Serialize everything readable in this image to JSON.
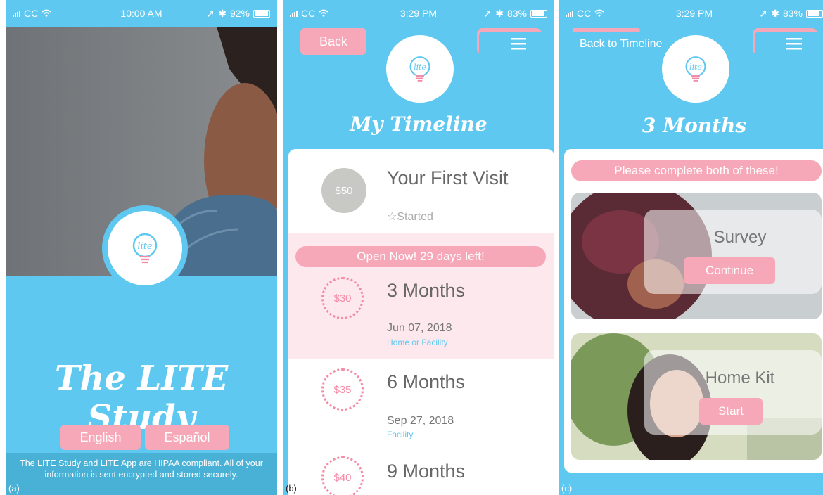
{
  "panel_a": {
    "status": {
      "carrier": "CC",
      "time": "10:00 AM",
      "battery": "92%",
      "battery_level": 0.92
    },
    "title": "The LITE Study",
    "logo_text": "lite",
    "buttons": {
      "english": "English",
      "espanol": "Español"
    },
    "disclaimer": "The LITE Study and LITE App are HIPAA compliant. All of your information is sent encrypted and stored securely.",
    "label": "(a)"
  },
  "panel_b": {
    "status": {
      "carrier": "CC",
      "time": "3:29 PM",
      "battery": "83%",
      "battery_level": 0.83
    },
    "back_label": "Back",
    "logo_text": "lite",
    "title": "My Timeline",
    "open_banner": "Open Now!  29 days left!",
    "items": [
      {
        "amount": "$50",
        "title": "Your First Visit",
        "status": "☆Started",
        "date": "",
        "location": ""
      },
      {
        "amount": "$30",
        "title": "3 Months",
        "status": "",
        "date": "Jun 07, 2018",
        "location": "Home or Facility"
      },
      {
        "amount": "$35",
        "title": "6 Months",
        "status": "",
        "date": "Sep 27, 2018",
        "location": "Facility"
      },
      {
        "amount": "$40",
        "title": "9 Months",
        "status": "",
        "date": "",
        "location": ""
      }
    ],
    "label": "(b)"
  },
  "panel_c": {
    "status": {
      "carrier": "CC",
      "time": "3:29 PM",
      "battery": "83%",
      "battery_level": 0.83
    },
    "back_label": "Back to Timeline",
    "logo_text": "lite",
    "title": "3 Months",
    "instruction": "Please complete both of these!",
    "tasks": [
      {
        "title": "Survey",
        "button": "Continue"
      },
      {
        "title": "Home Kit",
        "button": "Start"
      }
    ],
    "label": "(c)"
  },
  "colors": {
    "sky": "#5ec8f0",
    "pink": "#f7a8b8",
    "coin_pink": "#f48aa4",
    "highlight": "#fde8ee"
  }
}
